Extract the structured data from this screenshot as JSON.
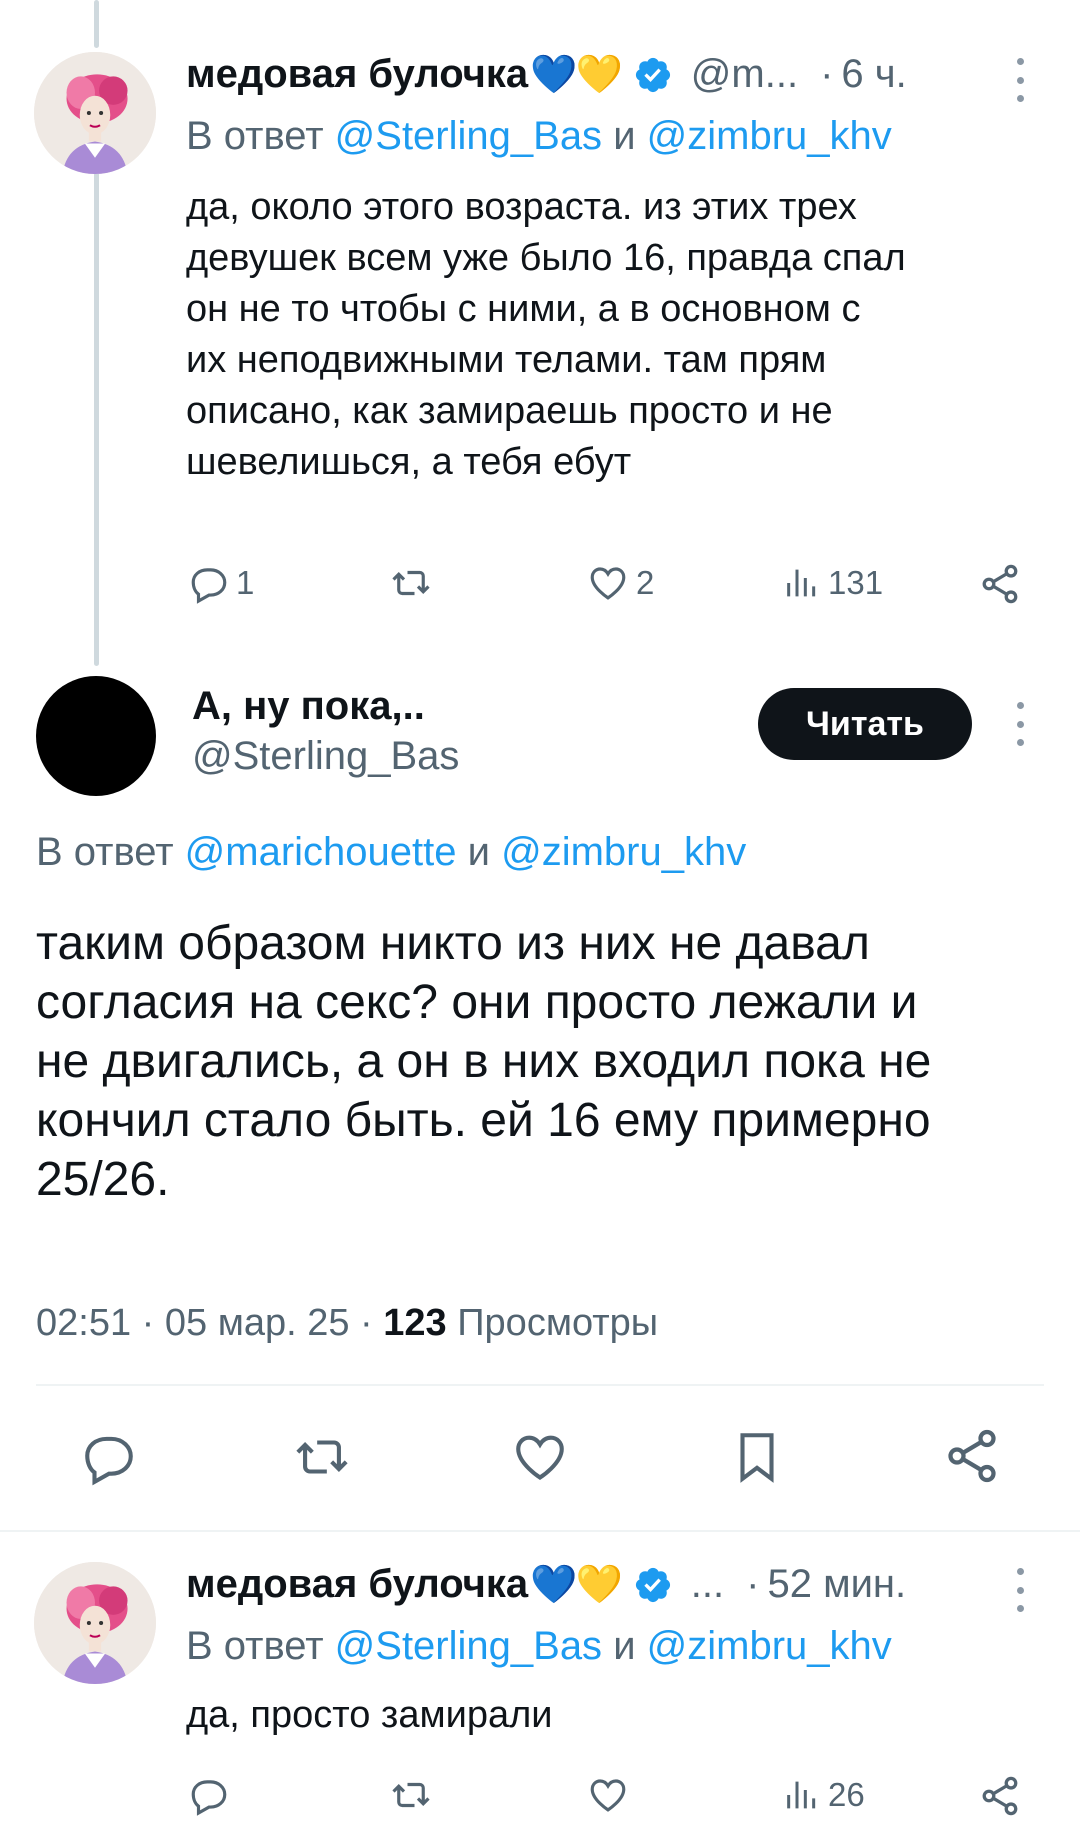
{
  "tweet1": {
    "display_name": "медовая булочка",
    "hearts": [
      "💙",
      "💛"
    ],
    "handle": "@m...",
    "separator": "·",
    "time": "6 ч.",
    "reply_prefix": "В ответ",
    "reply_user1": "@Sterling_Bas",
    "reply_and": "и",
    "reply_user2": "@zimbru_khv",
    "lines": [
      "да, около этого возраста. из этих трех",
      "девушек всем уже было 16, правда спал",
      "он не то чтобы с ними, а в основном с",
      "их неподвижными телами. там прям",
      "описано, как замираешь просто и не",
      "шевелишься, а тебя ебут"
    ],
    "replies": "1",
    "likes": "2",
    "views": "131"
  },
  "main": {
    "display_name": "А, ну пока,..",
    "handle": "@Sterling_Bas",
    "follow_label": "Читать",
    "reply_prefix": "В ответ",
    "reply_user1": "@marichouette",
    "reply_and": "и",
    "reply_user2": "@zimbru_khv",
    "lines": [
      "таким образом никто из них не давал",
      "согласия на секс? они просто лежали и",
      "не двигались, а он в них входил пока не",
      "кончил стало быть. ей 16 ему примерно",
      "25/26."
    ],
    "time": "02:51",
    "date": "05 мар. 25",
    "views_count": "123",
    "views_label": "Просмотры"
  },
  "tweet3": {
    "display_name": "медовая булочка",
    "hearts": [
      "💙",
      "💛"
    ],
    "handle": "...",
    "separator": "·",
    "time": "52 мин.",
    "reply_prefix": "В ответ",
    "reply_user1": "@Sterling_Bas",
    "reply_and": "и",
    "reply_user2": "@zimbru_khv",
    "lines": [
      "да, просто замирали"
    ],
    "views": "26"
  },
  "colors": {
    "mention": "#1d9bf0",
    "secondary_text": "#536471",
    "verified": "#1d9bf0",
    "follow_button": "#0f1419"
  },
  "icons": [
    "reply-icon",
    "retweet-icon",
    "like-icon",
    "views-icon",
    "share-icon",
    "bookmark-icon",
    "verified-icon",
    "more-icon"
  ]
}
